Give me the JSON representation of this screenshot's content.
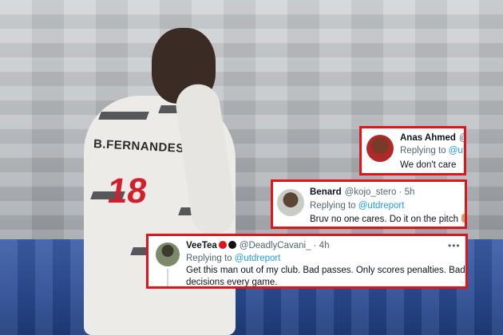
{
  "colors": {
    "card_border": "#e0151c",
    "link": "#1d9bf0",
    "muted": "#536471",
    "text": "#0f1419"
  },
  "background": {
    "jersey_name": "B.FERNANDES",
    "jersey_number": "18"
  },
  "tweets": [
    {
      "name": "Anas Ahmed",
      "handle": "@",
      "reply_prefix": "Replying to",
      "reply_to": "@utd",
      "text": "We don't care"
    },
    {
      "name": "Benard",
      "handle": "@kojo_stero · 5h",
      "reply_prefix": "Replying to",
      "reply_to": "@utdreport",
      "text": "Bruv no one cares. Do it on the pitch"
    },
    {
      "name": "VeeTea",
      "handle": "@DeadlyCavani_ · 4h",
      "reply_prefix": "Replying to",
      "reply_to": "@utdreport",
      "text": "Get this man out of my club. Bad passes. Only scores penalties. Bad decisions every game.",
      "more": "•••"
    }
  ]
}
